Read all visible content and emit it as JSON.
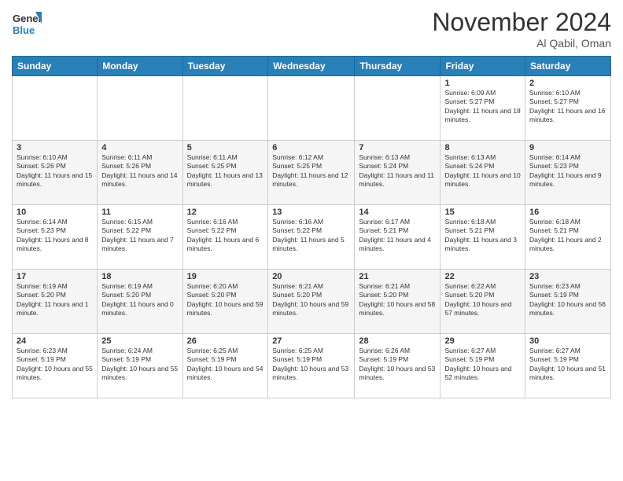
{
  "logo": {
    "general": "General",
    "blue": "Blue"
  },
  "header": {
    "month": "November 2024",
    "location": "Al Qabil, Oman"
  },
  "weekdays": [
    "Sunday",
    "Monday",
    "Tuesday",
    "Wednesday",
    "Thursday",
    "Friday",
    "Saturday"
  ],
  "weeks": [
    [
      {
        "day": "",
        "info": ""
      },
      {
        "day": "",
        "info": ""
      },
      {
        "day": "",
        "info": ""
      },
      {
        "day": "",
        "info": ""
      },
      {
        "day": "",
        "info": ""
      },
      {
        "day": "1",
        "info": "Sunrise: 6:09 AM\nSunset: 5:27 PM\nDaylight: 11 hours and 18 minutes."
      },
      {
        "day": "2",
        "info": "Sunrise: 6:10 AM\nSunset: 5:27 PM\nDaylight: 11 hours and 16 minutes."
      }
    ],
    [
      {
        "day": "3",
        "info": "Sunrise: 6:10 AM\nSunset: 5:26 PM\nDaylight: 11 hours and 15 minutes."
      },
      {
        "day": "4",
        "info": "Sunrise: 6:11 AM\nSunset: 5:26 PM\nDaylight: 11 hours and 14 minutes."
      },
      {
        "day": "5",
        "info": "Sunrise: 6:11 AM\nSunset: 5:25 PM\nDaylight: 11 hours and 13 minutes."
      },
      {
        "day": "6",
        "info": "Sunrise: 6:12 AM\nSunset: 5:25 PM\nDaylight: 11 hours and 12 minutes."
      },
      {
        "day": "7",
        "info": "Sunrise: 6:13 AM\nSunset: 5:24 PM\nDaylight: 11 hours and 11 minutes."
      },
      {
        "day": "8",
        "info": "Sunrise: 6:13 AM\nSunset: 5:24 PM\nDaylight: 11 hours and 10 minutes."
      },
      {
        "day": "9",
        "info": "Sunrise: 6:14 AM\nSunset: 5:23 PM\nDaylight: 11 hours and 9 minutes."
      }
    ],
    [
      {
        "day": "10",
        "info": "Sunrise: 6:14 AM\nSunset: 5:23 PM\nDaylight: 11 hours and 8 minutes."
      },
      {
        "day": "11",
        "info": "Sunrise: 6:15 AM\nSunset: 5:22 PM\nDaylight: 11 hours and 7 minutes."
      },
      {
        "day": "12",
        "info": "Sunrise: 6:16 AM\nSunset: 5:22 PM\nDaylight: 11 hours and 6 minutes."
      },
      {
        "day": "13",
        "info": "Sunrise: 6:16 AM\nSunset: 5:22 PM\nDaylight: 11 hours and 5 minutes."
      },
      {
        "day": "14",
        "info": "Sunrise: 6:17 AM\nSunset: 5:21 PM\nDaylight: 11 hours and 4 minutes."
      },
      {
        "day": "15",
        "info": "Sunrise: 6:18 AM\nSunset: 5:21 PM\nDaylight: 11 hours and 3 minutes."
      },
      {
        "day": "16",
        "info": "Sunrise: 6:18 AM\nSunset: 5:21 PM\nDaylight: 11 hours and 2 minutes."
      }
    ],
    [
      {
        "day": "17",
        "info": "Sunrise: 6:19 AM\nSunset: 5:20 PM\nDaylight: 11 hours and 1 minute."
      },
      {
        "day": "18",
        "info": "Sunrise: 6:19 AM\nSunset: 5:20 PM\nDaylight: 11 hours and 0 minutes."
      },
      {
        "day": "19",
        "info": "Sunrise: 6:20 AM\nSunset: 5:20 PM\nDaylight: 10 hours and 59 minutes."
      },
      {
        "day": "20",
        "info": "Sunrise: 6:21 AM\nSunset: 5:20 PM\nDaylight: 10 hours and 59 minutes."
      },
      {
        "day": "21",
        "info": "Sunrise: 6:21 AM\nSunset: 5:20 PM\nDaylight: 10 hours and 58 minutes."
      },
      {
        "day": "22",
        "info": "Sunrise: 6:22 AM\nSunset: 5:20 PM\nDaylight: 10 hours and 57 minutes."
      },
      {
        "day": "23",
        "info": "Sunrise: 6:23 AM\nSunset: 5:19 PM\nDaylight: 10 hours and 56 minutes."
      }
    ],
    [
      {
        "day": "24",
        "info": "Sunrise: 6:23 AM\nSunset: 5:19 PM\nDaylight: 10 hours and 55 minutes."
      },
      {
        "day": "25",
        "info": "Sunrise: 6:24 AM\nSunset: 5:19 PM\nDaylight: 10 hours and 55 minutes."
      },
      {
        "day": "26",
        "info": "Sunrise: 6:25 AM\nSunset: 5:19 PM\nDaylight: 10 hours and 54 minutes."
      },
      {
        "day": "27",
        "info": "Sunrise: 6:25 AM\nSunset: 5:19 PM\nDaylight: 10 hours and 53 minutes."
      },
      {
        "day": "28",
        "info": "Sunrise: 6:26 AM\nSunset: 5:19 PM\nDaylight: 10 hours and 53 minutes."
      },
      {
        "day": "29",
        "info": "Sunrise: 6:27 AM\nSunset: 5:19 PM\nDaylight: 10 hours and 52 minutes."
      },
      {
        "day": "30",
        "info": "Sunrise: 6:27 AM\nSunset: 5:19 PM\nDaylight: 10 hours and 51 minutes."
      }
    ]
  ]
}
